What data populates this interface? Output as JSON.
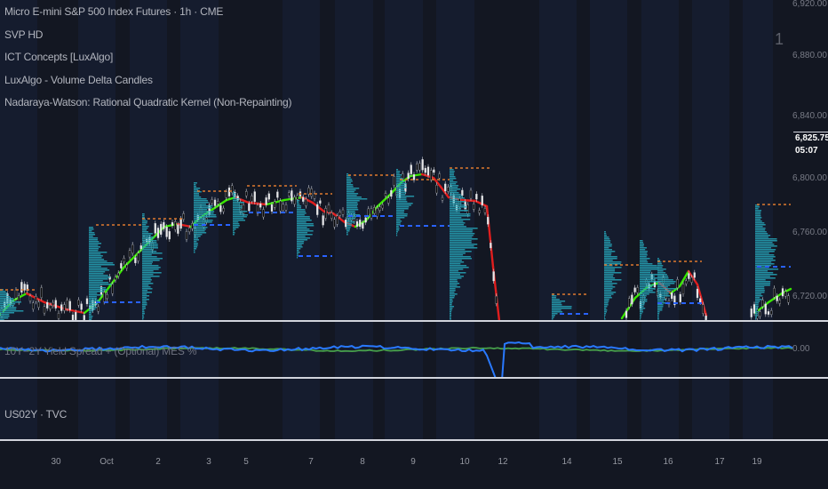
{
  "legend": {
    "symbol": "Micro E-mini S&P 500 Index Futures · 1h · CME",
    "indicators": [
      "SVP HD",
      "ICT Concepts [LuxAlgo]",
      "LuxAlgo - Volume Delta Candles",
      "Nadaraya-Watson: Rational Quadratic Kernel (Non-Repainting)"
    ]
  },
  "price_axis": {
    "labels": [
      "6,920.00",
      "6,880.00",
      "6,840.00",
      "6,800.00",
      "6,760.00",
      "6,720.00"
    ],
    "last_price": "6,825.75",
    "countdown": "05:07"
  },
  "overlay_number": "1",
  "panes": {
    "spread": {
      "title": "10Y−2Y Yield Spread + (Optional) MES %",
      "axis_label": "0.00"
    },
    "us02y": {
      "title": "US02Y · TVC"
    }
  },
  "time_axis": {
    "ticks": [
      "30",
      "Oct",
      "2",
      "3",
      "5",
      "7",
      "8",
      "9",
      "10",
      "12",
      "14",
      "15",
      "16",
      "17",
      "19"
    ]
  },
  "colors": {
    "background": "#131722",
    "session_band": "#151c2e",
    "kernel_up": "#39e600",
    "kernel_down": "#e01e1e",
    "profile": "#26a6b8",
    "level_orange": "#e07a2e",
    "level_blue": "#2962ff",
    "spread_line": "#2979ff",
    "spread_green": "#4caf50"
  }
}
